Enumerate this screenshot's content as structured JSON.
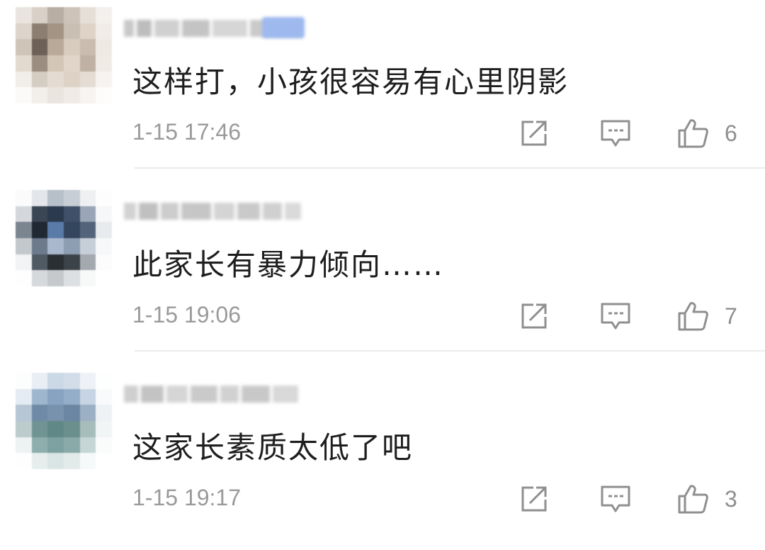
{
  "comments": [
    {
      "text": "这样打，小孩很容易有心里阴影",
      "time": "1-15 17:46",
      "likes": "6",
      "has_vip_badge": true
    },
    {
      "text": "此家长有暴力倾向……",
      "time": "1-15 19:06",
      "likes": "7",
      "has_vip_badge": false
    },
    {
      "text": "这家长素质太低了吧",
      "time": "1-15 19:17",
      "likes": "3",
      "has_vip_badge": false
    }
  ],
  "icons": {
    "share": "share-icon",
    "reply": "reply-icon",
    "like": "thumbs-up-icon"
  },
  "colors": {
    "text": "#1e1e1e",
    "meta": "#9a9a9a",
    "icon": "#8f8f8f",
    "divider": "#ececec",
    "vip_badge": "#9db9ee"
  }
}
